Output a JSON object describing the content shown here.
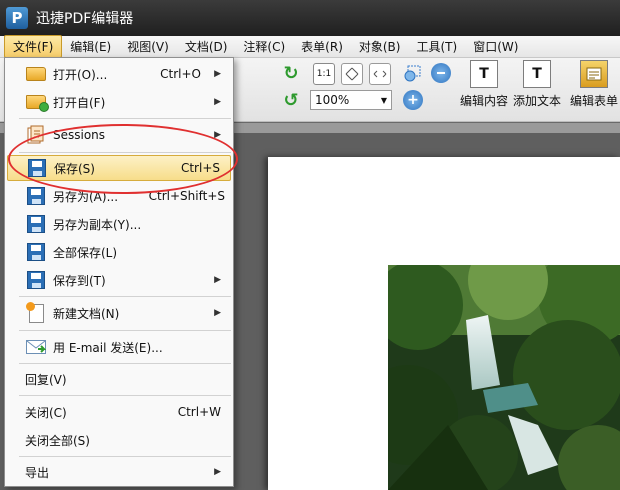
{
  "app": {
    "title": "迅捷PDF编辑器",
    "logo_letter": "P"
  },
  "menubar": {
    "items": [
      "文件(F)",
      "编辑(E)",
      "视图(V)",
      "文档(D)",
      "注释(C)",
      "表单(R)",
      "对象(B)",
      "工具(T)",
      "窗口(W)"
    ]
  },
  "toolbar": {
    "zoom_value": "100%",
    "zoom_in_symbol": "+",
    "fit_label": "1:1",
    "edit_content_label": "编辑内容",
    "add_text_label": "添加文本",
    "edit_form_label": "编辑表单",
    "edit_content_icon": "T",
    "add_text_icon": "T",
    "rotate_cw_symbol": "↻",
    "rotate_ccw_symbol": "↺",
    "dropdown_arrow": "▼"
  },
  "file_menu": {
    "items": [
      {
        "label": "打开(O)...",
        "shortcut": "Ctrl+O",
        "arrow": "▶"
      },
      {
        "label": "打开自(F)",
        "shortcut": "",
        "arrow": "▶"
      },
      {
        "label": "Sessions",
        "shortcut": "",
        "arrow": "▶"
      },
      {
        "label": "保存(S)",
        "shortcut": "Ctrl+S",
        "arrow": ""
      },
      {
        "label": "另存为(A)...",
        "shortcut": "Ctrl+Shift+S",
        "arrow": ""
      },
      {
        "label": "另存为副本(Y)...",
        "shortcut": "",
        "arrow": ""
      },
      {
        "label": "全部保存(L)",
        "shortcut": "",
        "arrow": ""
      },
      {
        "label": "保存到(T)",
        "shortcut": "",
        "arrow": "▶"
      },
      {
        "label": "新建文档(N)",
        "shortcut": "",
        "arrow": "▶"
      },
      {
        "label": "用 E-mail 发送(E)...",
        "shortcut": "",
        "arrow": ""
      },
      {
        "label": "回复(V)",
        "shortcut": "",
        "arrow": ""
      },
      {
        "label": "关闭(C)",
        "shortcut": "Ctrl+W",
        "arrow": ""
      },
      {
        "label": "关闭全部(S)",
        "shortcut": "",
        "arrow": ""
      },
      {
        "label": "导出",
        "shortcut": "",
        "arrow": "▶"
      }
    ]
  },
  "colors": {
    "accent": "#f7dd8a",
    "annotation": "#e03030"
  }
}
